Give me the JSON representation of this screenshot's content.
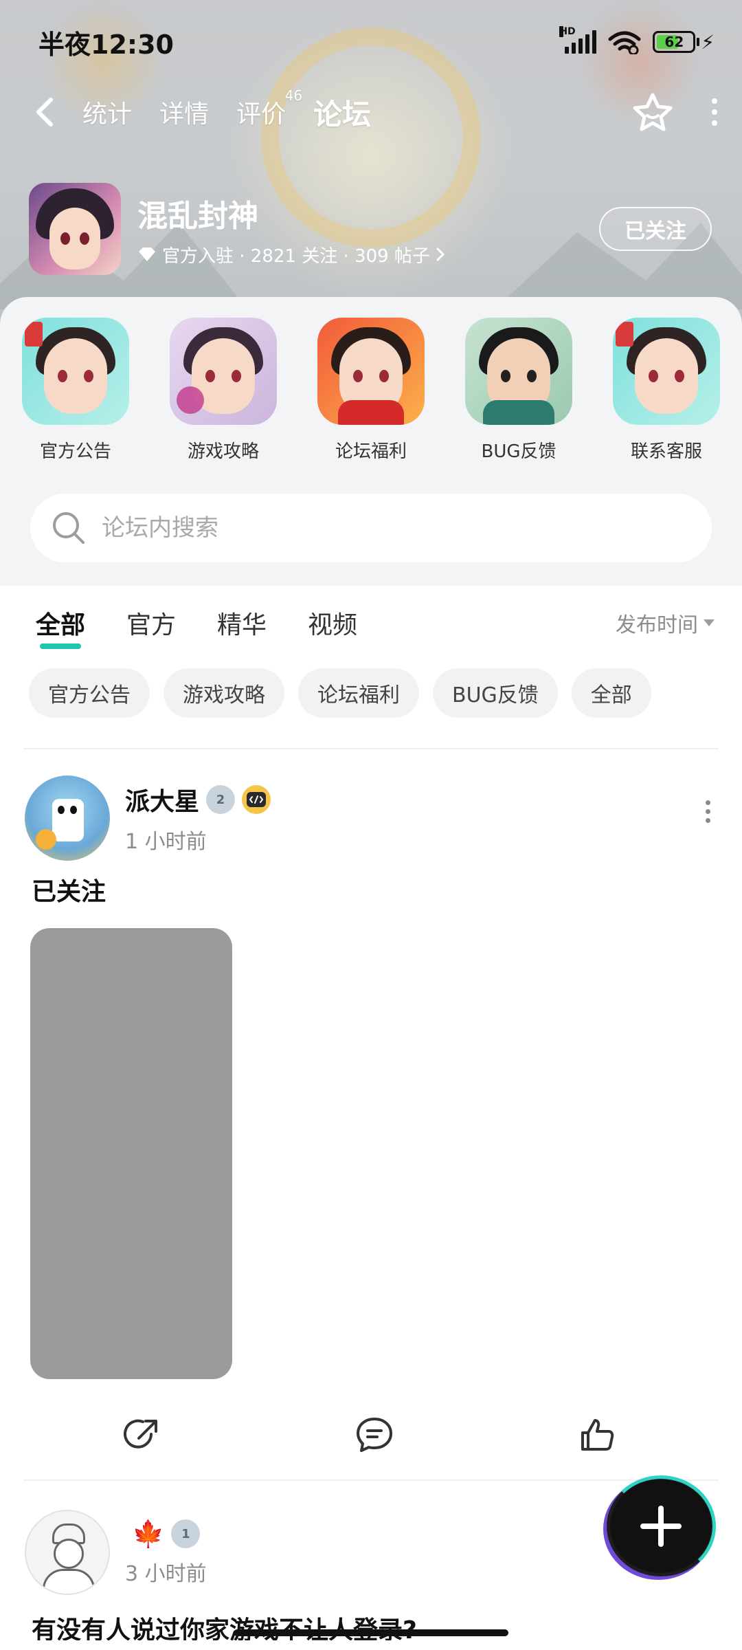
{
  "status_bar": {
    "time": "半夜12:30",
    "signal_label": "HD",
    "battery": "62"
  },
  "nav": {
    "tabs": [
      {
        "label": "统计"
      },
      {
        "label": "详情"
      },
      {
        "label": "评价",
        "badge": "46"
      },
      {
        "label": "论坛"
      }
    ]
  },
  "game": {
    "title": "混乱封神",
    "meta": "官方入驻 · 2821 关注 · 309 帖子",
    "follow_label": "已关注"
  },
  "shortcuts": [
    {
      "label": "官方公告"
    },
    {
      "label": "游戏攻略"
    },
    {
      "label": "论坛福利"
    },
    {
      "label": "BUG反馈"
    },
    {
      "label": "联系客服"
    }
  ],
  "search": {
    "placeholder": "论坛内搜索"
  },
  "filter_tabs": [
    {
      "label": "全部"
    },
    {
      "label": "官方"
    },
    {
      "label": "精华"
    },
    {
      "label": "视频"
    }
  ],
  "sort_label": "发布时间",
  "chips": [
    {
      "label": "官方公告"
    },
    {
      "label": "游戏攻略"
    },
    {
      "label": "论坛福利"
    },
    {
      "label": "BUG反馈"
    },
    {
      "label": "全部"
    }
  ],
  "posts": [
    {
      "author": "派大星",
      "time": "1 小时前",
      "text": "已关注",
      "badge": "2"
    },
    {
      "author": "",
      "time": "3 小时前",
      "text": "有没有人说过你家游戏不让人登录?",
      "badge": "1"
    }
  ],
  "colors": {
    "accent": "#20c4b0",
    "image_placeholder": "#9b9b9b"
  }
}
